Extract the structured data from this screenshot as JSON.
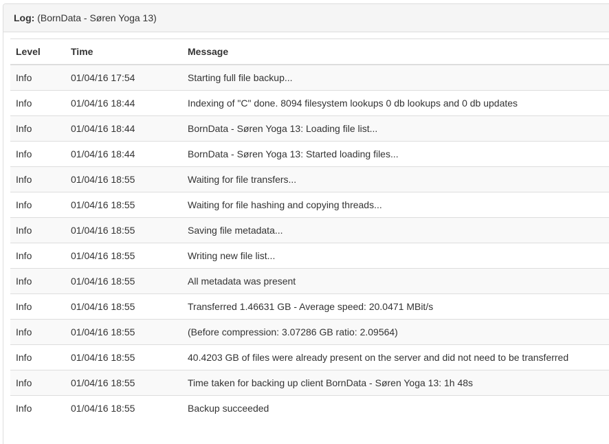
{
  "panel": {
    "label": "Log:",
    "subtitle": "(BornData - Søren Yoga 13)"
  },
  "table": {
    "headers": {
      "level": "Level",
      "time": "Time",
      "message": "Message"
    },
    "rows": [
      {
        "level": "Info",
        "time": "01/04/16 17:54",
        "message": "Starting full file backup..."
      },
      {
        "level": "Info",
        "time": "01/04/16 18:44",
        "message": "Indexing of \"C\" done. 8094 filesystem lookups 0 db lookups and 0 db updates"
      },
      {
        "level": "Info",
        "time": "01/04/16 18:44",
        "message": "BornData - Søren Yoga 13: Loading file list..."
      },
      {
        "level": "Info",
        "time": "01/04/16 18:44",
        "message": "BornData - Søren Yoga 13: Started loading files..."
      },
      {
        "level": "Info",
        "time": "01/04/16 18:55",
        "message": "Waiting for file transfers..."
      },
      {
        "level": "Info",
        "time": "01/04/16 18:55",
        "message": "Waiting for file hashing and copying threads..."
      },
      {
        "level": "Info",
        "time": "01/04/16 18:55",
        "message": "Saving file metadata..."
      },
      {
        "level": "Info",
        "time": "01/04/16 18:55",
        "message": "Writing new file list..."
      },
      {
        "level": "Info",
        "time": "01/04/16 18:55",
        "message": "All metadata was present"
      },
      {
        "level": "Info",
        "time": "01/04/16 18:55",
        "message": "Transferred 1.46631 GB - Average speed: 20.0471 MBit/s"
      },
      {
        "level": "Info",
        "time": "01/04/16 18:55",
        "message": "(Before compression: 3.07286 GB ratio: 2.09564)"
      },
      {
        "level": "Info",
        "time": "01/04/16 18:55",
        "message": "40.4203 GB of files were already present on the server and did not need to be transferred"
      },
      {
        "level": "Info",
        "time": "01/04/16 18:55",
        "message": "Time taken for backing up client BornData - Søren Yoga 13: 1h 48s"
      },
      {
        "level": "Info",
        "time": "01/04/16 18:55",
        "message": "Backup succeeded"
      }
    ]
  }
}
